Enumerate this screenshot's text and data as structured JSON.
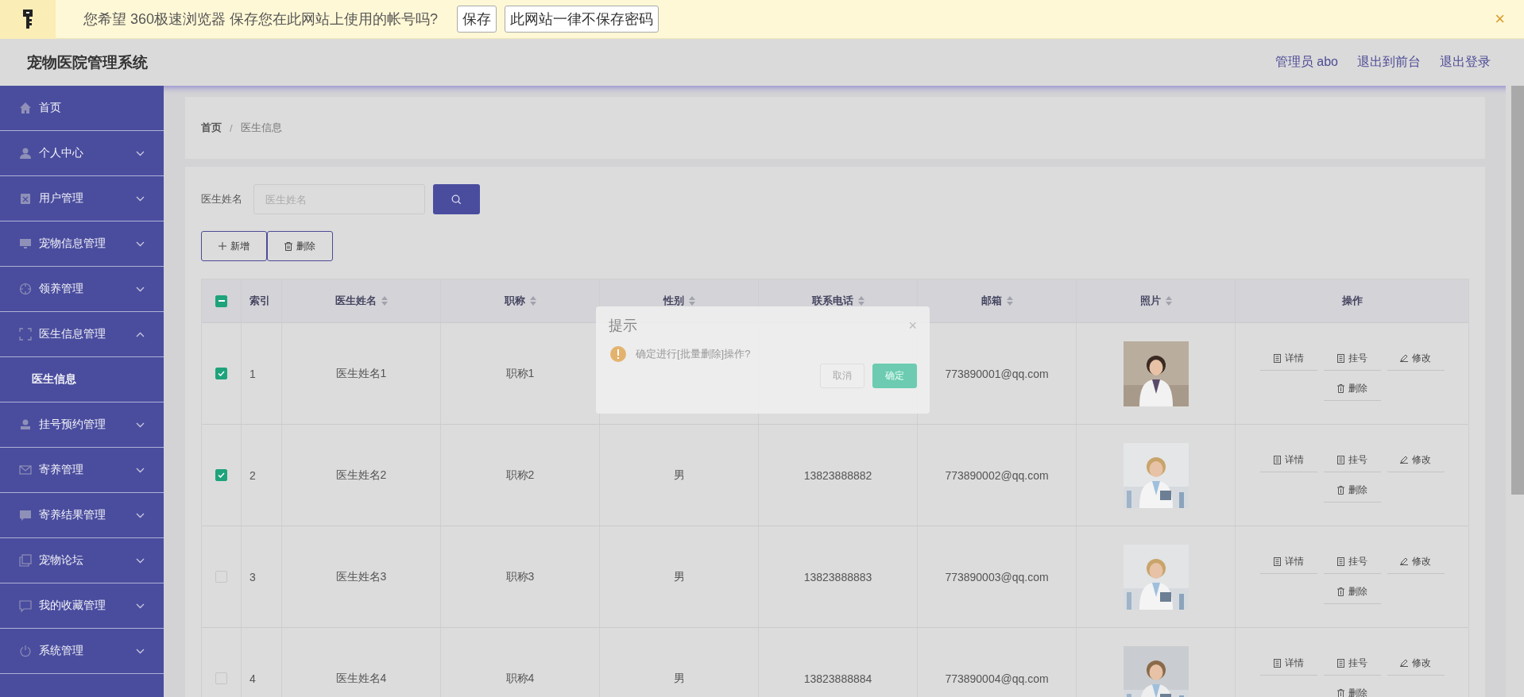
{
  "password_bar": {
    "message": "您希望 360极速浏览器 保存您在此网站上使用的帐号吗?",
    "buttons": [
      "保存",
      "此网站一律不保存密码"
    ],
    "close": "×"
  },
  "header": {
    "title": "宠物医院管理系统",
    "links": [
      "管理员 abo",
      "退出到前台",
      "退出登录"
    ]
  },
  "sidebar": {
    "items": [
      {
        "label": "首页",
        "kind": "link"
      },
      {
        "label": "个人中心",
        "kind": "submenu",
        "expanded": false
      },
      {
        "label": "用户管理",
        "kind": "submenu",
        "expanded": false
      },
      {
        "label": "宠物信息管理",
        "kind": "submenu",
        "expanded": false
      },
      {
        "label": "领养管理",
        "kind": "submenu",
        "expanded": false
      },
      {
        "label": "医生信息管理",
        "kind": "submenu",
        "expanded": true,
        "children": [
          {
            "label": "医生信息"
          }
        ]
      },
      {
        "label": "挂号预约管理",
        "kind": "submenu",
        "expanded": false
      },
      {
        "label": "寄养管理",
        "kind": "submenu",
        "expanded": false
      },
      {
        "label": "寄养结果管理",
        "kind": "submenu",
        "expanded": false
      },
      {
        "label": "宠物论坛",
        "kind": "submenu",
        "expanded": false
      },
      {
        "label": "我的收藏管理",
        "kind": "submenu",
        "expanded": false
      },
      {
        "label": "系统管理",
        "kind": "submenu",
        "expanded": false
      }
    ]
  },
  "breadcrumb": {
    "items": [
      "首页",
      "医生信息"
    ],
    "separator": "/"
  },
  "search": {
    "label": "医生姓名",
    "placeholder": "医生姓名"
  },
  "toolbar": [
    {
      "kind": "add",
      "label": "新增"
    },
    {
      "kind": "delete",
      "label": "删除"
    }
  ],
  "table": {
    "select_all": {
      "indeterminate": true
    },
    "columns": [
      {
        "label": "索引",
        "sortable": false
      },
      {
        "label": "医生姓名",
        "sortable": true
      },
      {
        "label": "职称",
        "sortable": true
      },
      {
        "label": "性别",
        "sortable": true
      },
      {
        "label": "联系电话",
        "sortable": true
      },
      {
        "label": "邮箱",
        "sortable": true
      },
      {
        "label": "照片",
        "sortable": true
      },
      {
        "label": "操作",
        "sortable": false
      }
    ],
    "rows": [
      {
        "checked": true,
        "index": "1",
        "name": "医生姓名1",
        "title": "职称1",
        "email": "773890001@qq.com",
        "actions": [
          {
            "kind": "detail",
            "label": "详情"
          },
          {
            "kind": "register",
            "label": "挂号"
          },
          {
            "kind": "edit",
            "label": "修改"
          },
          {
            "kind": "delete",
            "label": "删除"
          }
        ]
      },
      {
        "checked": true,
        "index": "2",
        "name": "医生姓名2",
        "title": "职称2",
        "gender": "男",
        "phone": "13823888882",
        "email": "773890002@qq.com",
        "actions": [
          {
            "kind": "detail",
            "label": "详情"
          },
          {
            "kind": "register",
            "label": "挂号"
          },
          {
            "kind": "edit",
            "label": "修改"
          },
          {
            "kind": "delete",
            "label": "删除"
          }
        ]
      },
      {
        "checked": false,
        "index": "3",
        "name": "医生姓名3",
        "title": "职称3",
        "gender": "男",
        "phone": "13823888883",
        "email": "773890003@qq.com",
        "actions": [
          {
            "kind": "detail",
            "label": "详情"
          },
          {
            "kind": "register",
            "label": "挂号"
          },
          {
            "kind": "edit",
            "label": "修改"
          },
          {
            "kind": "delete",
            "label": "删除"
          }
        ]
      },
      {
        "checked": false,
        "index": "4",
        "name": "医生姓名4",
        "title": "职称4",
        "gender": "男",
        "phone": "13823888884",
        "email": "773890004@qq.com",
        "actions": [
          {
            "kind": "detail",
            "label": "详情"
          },
          {
            "kind": "register",
            "label": "挂号"
          },
          {
            "kind": "edit",
            "label": "修改"
          },
          {
            "kind": "delete",
            "label": "删除"
          }
        ]
      }
    ]
  },
  "dialog": {
    "title": "提示",
    "close": "×",
    "message": "确定进行[批量删除]操作?",
    "buttons": [
      {
        "kind": "cancel",
        "label": "取消"
      },
      {
        "kind": "confirm",
        "label": "确定"
      }
    ]
  }
}
